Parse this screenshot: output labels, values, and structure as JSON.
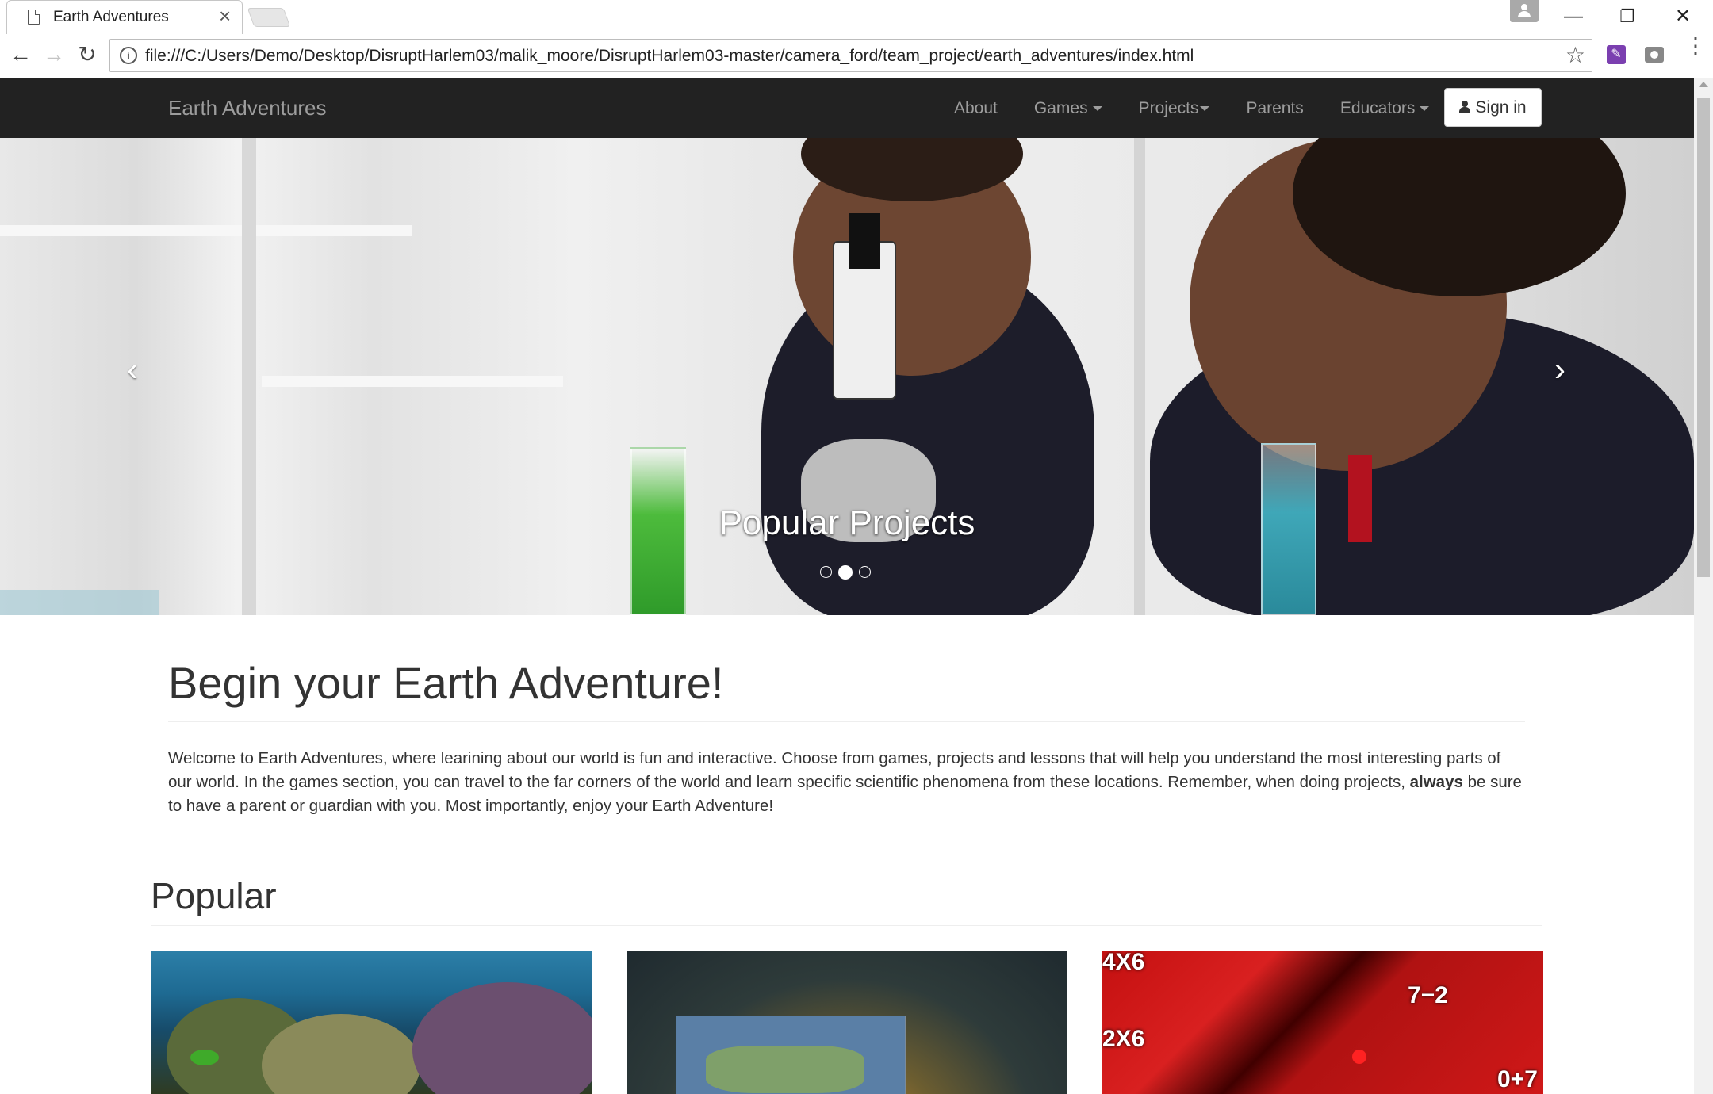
{
  "browser": {
    "tab_title": "Earth Adventures",
    "tab_close": "×",
    "url": "file:///C:/Users/Demo/Desktop/DisruptHarlem03/malik_moore/DisruptHarlem03-master/camera_ford/team_project/earth_adventures/index.html",
    "back": "←",
    "forward": "→",
    "reload": "↻",
    "info": "i",
    "star": "☆",
    "menu": "⋮",
    "minimize": "—",
    "restore": "❐",
    "close": "✕"
  },
  "navbar": {
    "brand": "Earth Adventures",
    "links": [
      {
        "label": "About",
        "dropdown": false
      },
      {
        "label": "Games",
        "dropdown": true
      },
      {
        "label": "Projects",
        "dropdown": true
      },
      {
        "label": "Parents",
        "dropdown": false
      },
      {
        "label": "Educators",
        "dropdown": true
      }
    ],
    "signin": "Sign in"
  },
  "carousel": {
    "caption": "Popular Projects",
    "prev": "‹",
    "next": "›",
    "slide_count": 3,
    "active_index": 1
  },
  "main": {
    "title": "Begin your Earth Adventure!",
    "intro_before_bold": "Welcome to Earth Adventures, where learining about our world is fun and interactive. Choose from games, projects and lessons that will help you understand the most interesting parts of our world. In the games section, you can travel to the far corners of the world and learn specific scientific phenomena from these locations. Remember, when doing projects, ",
    "intro_bold": "always",
    "intro_after_bold": " be sure to have a parent or guardian with you. Most importantly, enjoy your Earth Adventure!",
    "popular_title": "Popular"
  },
  "popular": {
    "math_labels": [
      "4X6",
      "7−2",
      "2X6",
      "0+7"
    ]
  },
  "colors": {
    "navbar_bg": "#222222",
    "nav_text": "#9d9d9d",
    "extension_purple": "#7b3fb0"
  },
  "icons": {
    "tab_favicon": "file-icon",
    "signin_icon": "user-icon",
    "site_info": "info-icon"
  }
}
